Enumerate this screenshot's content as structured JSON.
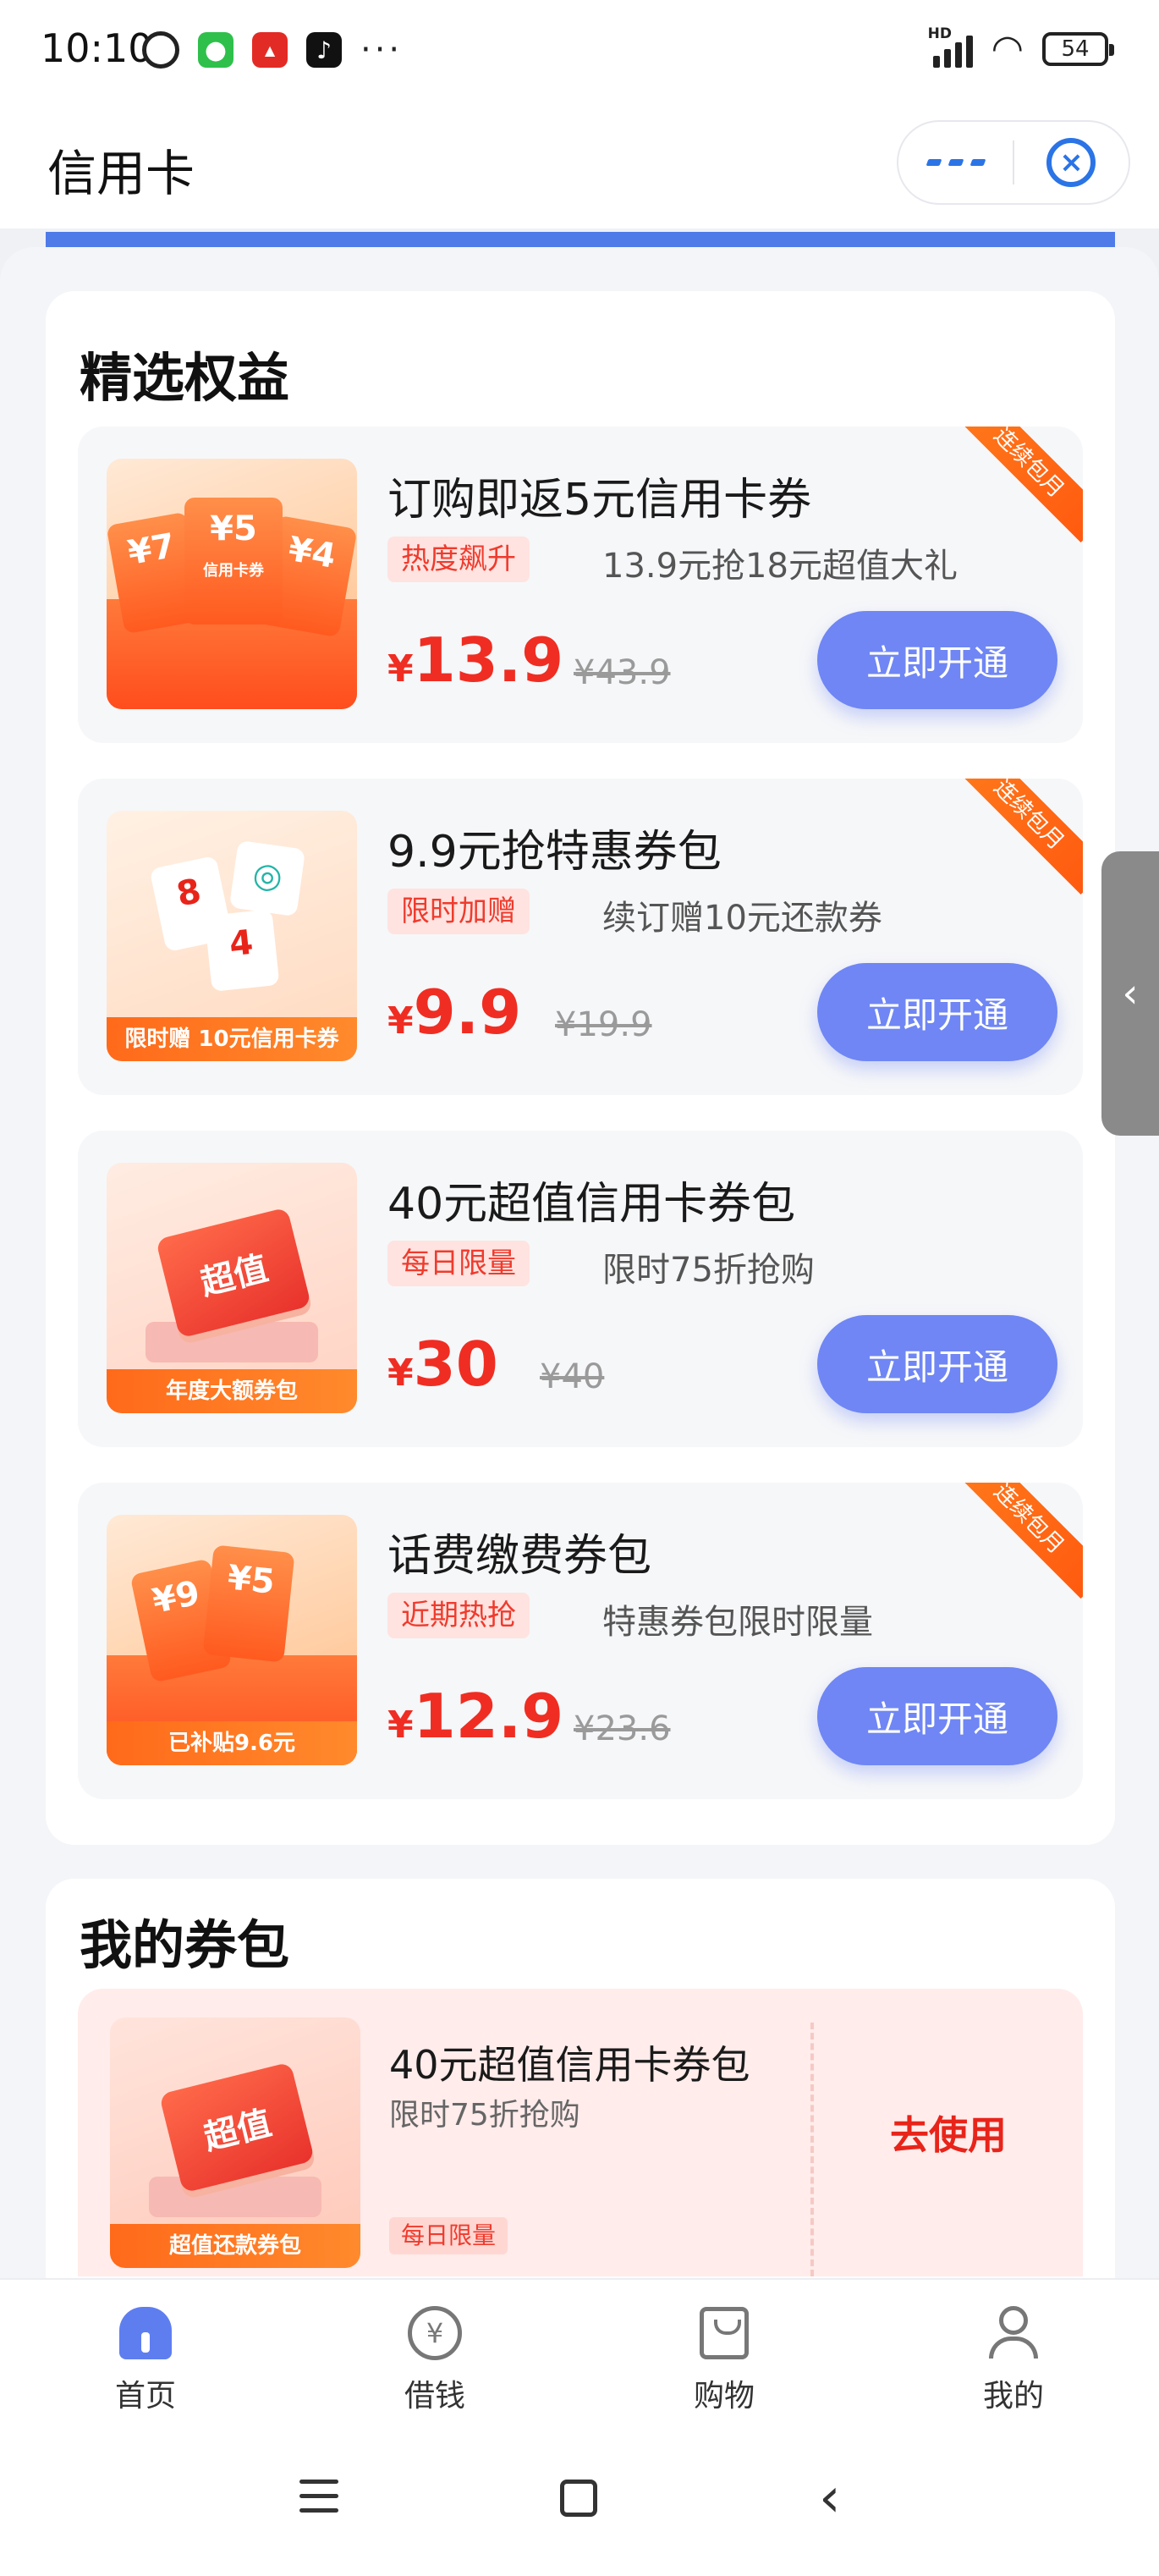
{
  "status_bar": {
    "time": "10:10",
    "network": "HD",
    "battery": "54"
  },
  "header": {
    "title": "信用卡"
  },
  "featured": {
    "title": "精选权益",
    "open_label": "立即开通",
    "ribbon_label": "连续包月",
    "cards": [
      {
        "title": "订购即返5元信用卡券",
        "tag": "热度飙升",
        "subtitle": "13.9元抢18元超值大礼",
        "currency": "¥",
        "price": "13.9",
        "original_price": "¥43.9",
        "thumb_ticket_left": "¥7",
        "thumb_ticket_center": "¥5",
        "thumb_ticket_right": "¥4",
        "thumb_label": "信用卡券",
        "ribbon": true
      },
      {
        "title": "9.9元抢特惠券包",
        "tag": "限时加赠",
        "subtitle": "续订赠10元还款券",
        "currency": "¥",
        "price": "9.9",
        "original_price": "¥19.9",
        "thumb_banner": "限时赠 10元信用卡券",
        "ribbon": true
      },
      {
        "title": "40元超值信用卡券包",
        "tag": "每日限量",
        "subtitle": "限时75折抢购",
        "currency": "¥",
        "price": "30",
        "original_price": "¥40",
        "thumb_chip": "超值",
        "thumb_banner": "年度大额券包",
        "ribbon": false
      },
      {
        "title": "话费缴费券包",
        "tag": "近期热抢",
        "subtitle": "特惠券包限时限量",
        "currency": "¥",
        "price": "12.9",
        "original_price": "¥23.6",
        "thumb_banner": "已补贴9.6元",
        "ribbon": true
      }
    ]
  },
  "my_coupons": {
    "title": "我的券包",
    "coupon": {
      "title": "40元超值信用卡券包",
      "subtitle": "限时75折抢购",
      "tag": "每日限量",
      "thumb_chip": "超值",
      "thumb_banner": "超值还款券包",
      "action": "去使用"
    }
  },
  "tabbar": {
    "items": [
      {
        "label": "首页",
        "icon": "home-icon",
        "active": true
      },
      {
        "label": "借钱",
        "icon": "yen-icon",
        "active": false
      },
      {
        "label": "购物",
        "icon": "shopping-bag-icon",
        "active": false
      },
      {
        "label": "我的",
        "icon": "profile-icon",
        "active": false
      }
    ]
  },
  "colors": {
    "accent_blue": "#6f86f4",
    "price_red": "#f02d22",
    "tag_bg": "#ffe3e0",
    "ribbon_orange": "#ff6a14",
    "active_tab": "#5e7ef0"
  }
}
